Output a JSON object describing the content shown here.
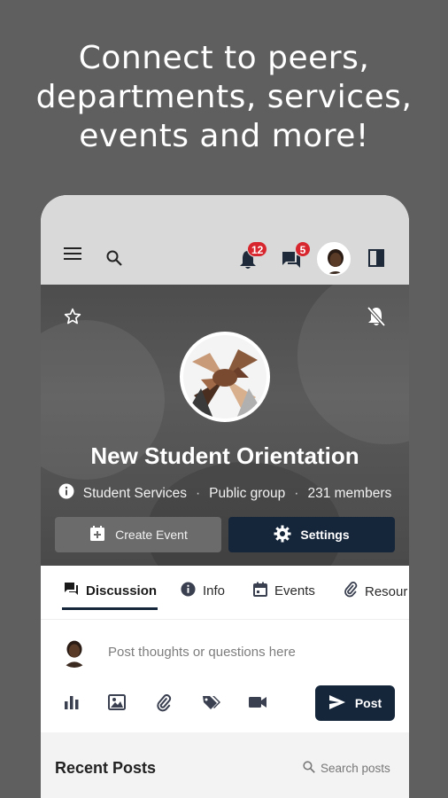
{
  "headline": [
    "Connect to peers,",
    "departments, services,",
    "events and more!"
  ],
  "appbar": {
    "notifications_count": "12",
    "messages_count": "5"
  },
  "group": {
    "title": "New Student Orientation",
    "department": "Student Services",
    "visibility": "Public group",
    "members": "231 members"
  },
  "actions": {
    "create_event": "Create Event",
    "settings": "Settings"
  },
  "tabs": [
    {
      "label": "Discussion",
      "icon": "chat-icon",
      "active": true
    },
    {
      "label": "Info",
      "icon": "info-icon",
      "active": false
    },
    {
      "label": "Events",
      "icon": "calendar-icon",
      "active": false
    },
    {
      "label": "Resour",
      "icon": "paperclip-icon",
      "active": false
    }
  ],
  "composer": {
    "placeholder": "Post thoughts or questions here",
    "post_label": "Post",
    "tools": [
      "poll-icon",
      "image-icon",
      "attachment-icon",
      "tag-icon",
      "video-icon"
    ]
  },
  "recent": {
    "title": "Recent Posts",
    "search_label": "Search posts"
  },
  "colors": {
    "background": "#5f5f5f",
    "primary": "#15253a",
    "badge": "#d7262e"
  }
}
